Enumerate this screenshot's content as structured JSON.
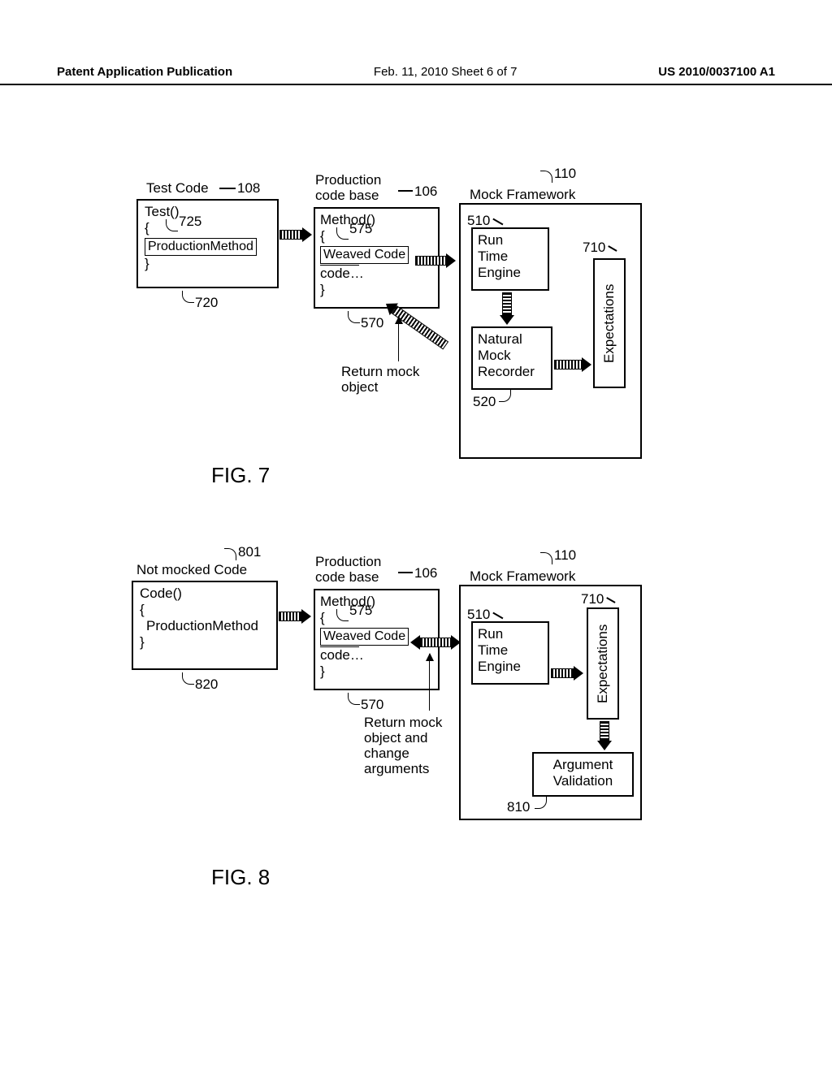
{
  "header": {
    "left": "Patent Application Publication",
    "center": "Feb. 11, 2010  Sheet 6 of 7",
    "right": "US 2010/0037100 A1"
  },
  "fig7": {
    "label": "FIG. 7",
    "testcode": {
      "title": "Test Code",
      "method": "Test()",
      "brace_open": "{",
      "inner": "ProductionMethod",
      "brace_close": "}",
      "ref": "108",
      "ref_body": "720",
      "ref_inner": "725"
    },
    "prodcode": {
      "title": "Production code base",
      "method": "Method()",
      "brace_open": "{",
      "weaved": "Weaved Code",
      "code": "code…",
      "brace_close": "}",
      "ref": "106",
      "ref_body": "570",
      "ref_weaved": "575"
    },
    "mock": {
      "title": "Mock Framework",
      "runtime": "Run Time Engine",
      "recorder": "Natural Mock Recorder",
      "expectations": "Expectations",
      "ref": "110",
      "ref_runtime": "510",
      "ref_recorder": "520",
      "ref_exp": "710"
    },
    "return_label": "Return mock object"
  },
  "fig8": {
    "label": "FIG. 8",
    "notmocked": {
      "title": "Not mocked Code",
      "method": "Code()",
      "brace_open": "{",
      "inner": "ProductionMethod",
      "brace_close": "}",
      "ref": "801",
      "ref_body": "820"
    },
    "prodcode": {
      "title": "Production code base",
      "method": "Method()",
      "brace_open": "{",
      "weaved": "Weaved Code",
      "code": "code…",
      "brace_close": "}",
      "ref": "106",
      "ref_body": "570",
      "ref_weaved": "575"
    },
    "mock": {
      "title": "Mock Framework",
      "runtime": "Run Time Engine",
      "argval": "Argument Validation",
      "expectations": "Expectations",
      "ref": "110",
      "ref_runtime": "510",
      "ref_argval": "810",
      "ref_exp": "710"
    },
    "return_label": "Return mock object and change arguments"
  }
}
